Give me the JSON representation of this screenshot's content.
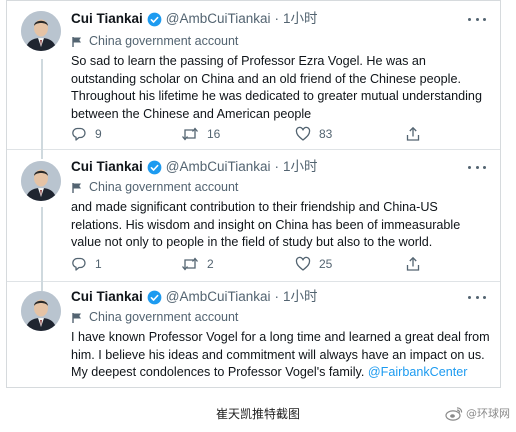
{
  "tweets": [
    {
      "name": "Cui Tiankai",
      "handle": "@AmbCuiTiankai",
      "separator": "·",
      "time": "1小时",
      "label": "China government account",
      "body": "So sad to learn the passing of Professor Ezra Vogel. He was an outstanding scholar on China and an old friend of the Chinese people. Throughout his lifetime he was dedicated to greater mutual understanding between the Chinese and American people",
      "mention": "",
      "replies": "9",
      "retweets": "16",
      "likes": "83"
    },
    {
      "name": "Cui Tiankai",
      "handle": "@AmbCuiTiankai",
      "separator": "·",
      "time": "1小时",
      "label": "China government account",
      "body": "and made significant contribution to their friendship and China-US relations. His wisdom and insight on China has been of immeasurable value not only to people in the field of study but also to the world.",
      "mention": "",
      "replies": "1",
      "retweets": "2",
      "likes": "25"
    },
    {
      "name": "Cui Tiankai",
      "handle": "@AmbCuiTiankai",
      "separator": "·",
      "time": "1小时",
      "label": "China government account",
      "body": "I have known Professor Vogel for a long time and learned a great deal from him. I believe his ideas and commitment will always have an impact on us. My deepest condolences to Professor Vogel's family. ",
      "mention": "@FairbankCenter",
      "replies": "",
      "retweets": "",
      "likes": ""
    }
  ],
  "caption": "崔天凯推特截图",
  "watermark": "@环球网",
  "icons": [
    "verified-badge-icon",
    "flag-icon",
    "more-icon",
    "reply-icon",
    "retweet-icon",
    "like-icon",
    "share-icon",
    "weibo-logo-icon"
  ],
  "colors": {
    "verified": "#1d9bf0",
    "secondary_text": "#536471",
    "mention": "#1d9bf0",
    "thread_line": "#cfd9de"
  }
}
